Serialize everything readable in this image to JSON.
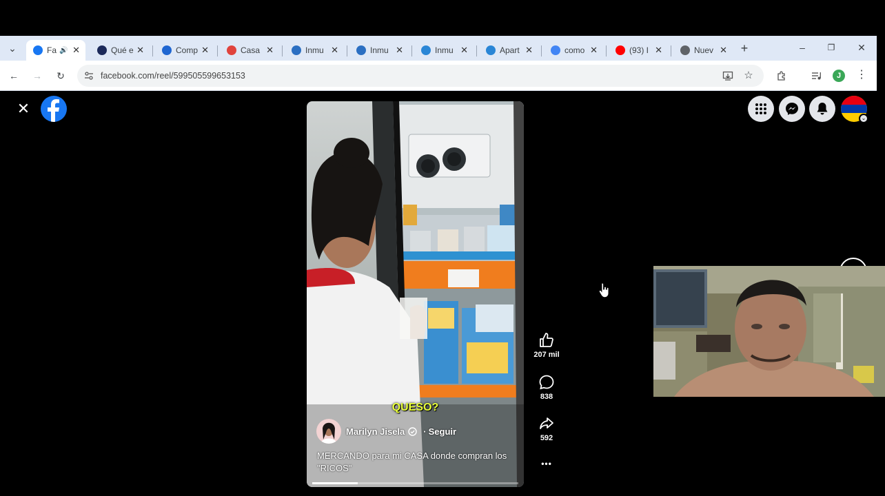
{
  "browser": {
    "tabs": [
      {
        "label": "Fa",
        "color": "#1877f2",
        "active": true,
        "audio": true
      },
      {
        "label": "Qué e",
        "color": "#1c2a5a"
      },
      {
        "label": "Comp",
        "color": "#1f66d1"
      },
      {
        "label": "Casa",
        "color": "#e0433d"
      },
      {
        "label": "Inmu",
        "color": "#2b6fc2"
      },
      {
        "label": "Inmu",
        "color": "#2b6fc2"
      },
      {
        "label": "Inmu",
        "color": "#2a86d6"
      },
      {
        "label": "Apart",
        "color": "#2a86d6"
      },
      {
        "label": "como",
        "color": "#4285f4"
      },
      {
        "label": "(93) I",
        "color": "#ff0000"
      },
      {
        "label": "Nuev",
        "color": "#5f6368"
      }
    ],
    "url": "facebook.com/reel/599505599653153",
    "profile_initial": "J"
  },
  "reel": {
    "caption_overlay": "QUESO?",
    "author": "Marilyn Jisela",
    "follow": "Seguir",
    "separator": "·",
    "description": "MERCANDO para mi CASA donde compran los \"RICOS\"",
    "progress": 0.22,
    "likes": "207 mil",
    "comments": "838",
    "shares": "592",
    "more": "•••"
  },
  "colors": {
    "facebook_blue": "#1877f2",
    "caption_yellow": "#e8ff3a",
    "tab_bar": "#dfe8f6"
  }
}
